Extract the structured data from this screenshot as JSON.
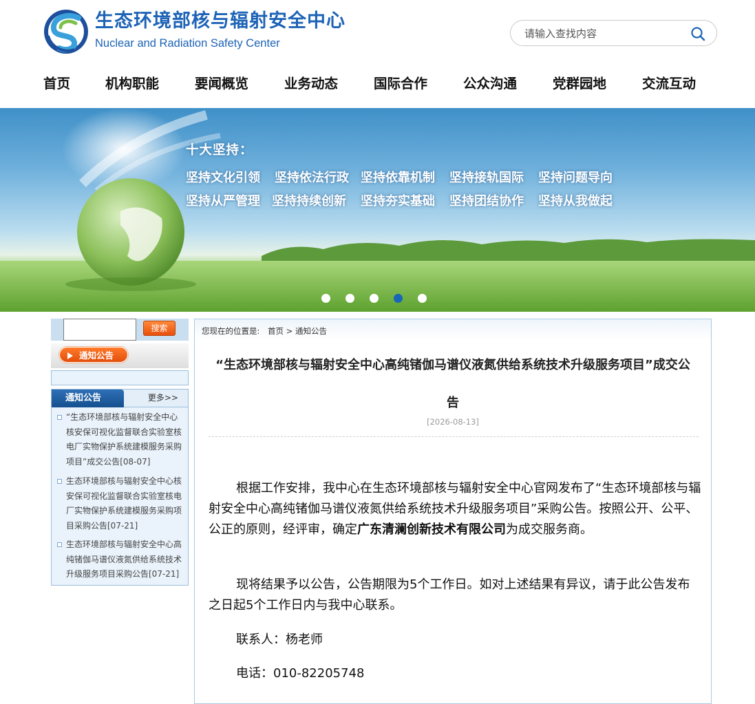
{
  "header": {
    "title_cn": "生态环境部核与辐射安全中心",
    "title_en": "Nuclear and Radiation Safety Center",
    "search_placeholder": "请输入查找内容"
  },
  "nav": [
    "首页",
    "机构职能",
    "要闻概览",
    "业务动态",
    "国际合作",
    "公众沟通",
    "党群园地",
    "交流互动"
  ],
  "banner": {
    "heading": "十大坚持：",
    "slogans": [
      "坚持文化引领",
      "坚持依法行政",
      "坚持依靠机制",
      "坚持接轨国际",
      "坚持问题导向",
      "坚持从严管理",
      "坚持持续创新",
      "坚持夯实基础",
      "坚持团结协作",
      "坚持从我做起"
    ],
    "active_slide": 4,
    "slide_count": 5
  },
  "sidebar": {
    "search_button": "搜索",
    "category": "通知公告",
    "list_title": "通知公告",
    "more": "更多>>",
    "items": [
      {
        "text": "“生态环境部核与辐射安全中心核安保可视化监督联合实验室核电厂实物保护系统建模服务采购项目”成交公告[08-07]"
      },
      {
        "text": "生态环境部核与辐射安全中心核安保可视化监督联合实验室核电厂实物保护系统建模服务采购项目采购公告[07-21]"
      },
      {
        "text": "生态环境部核与辐射安全中心高纯锗伽马谱仪液氮供给系统技术升级服务项目采购公告[07-21]"
      }
    ]
  },
  "article": {
    "location_label": "您现在的位置是:",
    "breadcrumb": "首页 > 通知公告",
    "title": "“生态环境部核与辐射安全中心高纯锗伽马谱仪液氮供给系统技术升级服务项目”成交公告",
    "date": "[2026-08-13]",
    "p1_before": "根据工作安排，我中心在生态环境部核与辐射安全中心官网发布了“生态环境部核与辐射安全中心高纯锗伽马谱仪液氮供给系统技术升级服务项目”采购公告。按照公开、公平、公正的原则，经评审，确定",
    "p1_company": "广东清澜创新技术有限公司",
    "p1_after": "为成交服务商。",
    "p2": "现将结果予以公告，公告期限为5个工作日。如对上述结果有异议，请于此公告发布之日起5个工作日内与我中心联系。",
    "contact": "联系人：杨老师",
    "phone": "电话：010-82205748"
  },
  "colors": {
    "brand_blue": "#1d63b6",
    "active_dot": "#1766b7",
    "orange_button": "#e8500d",
    "tab_blue": "#15508f"
  }
}
